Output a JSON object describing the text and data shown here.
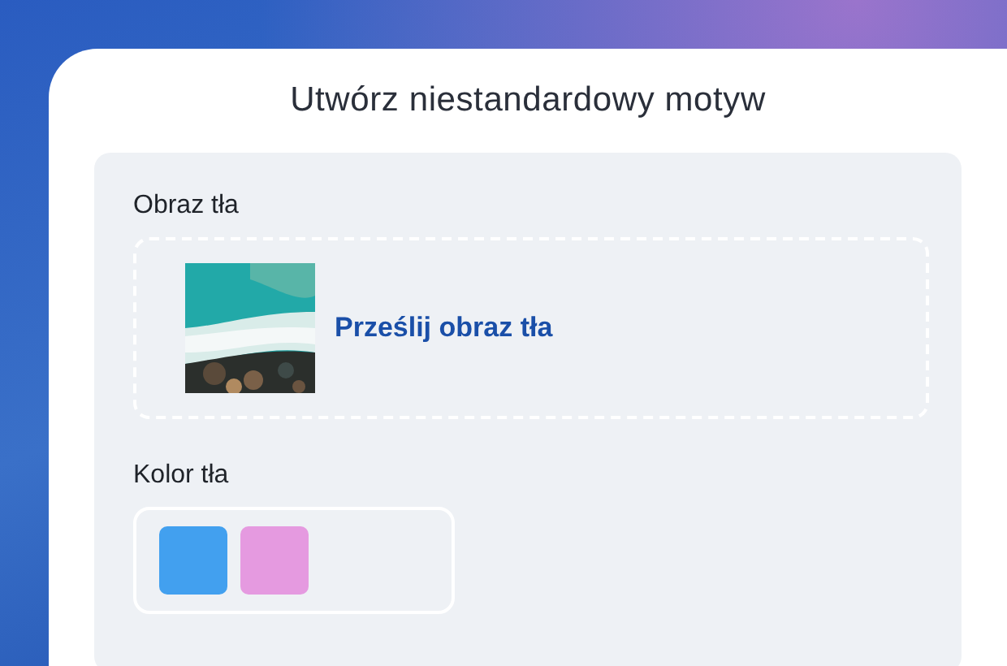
{
  "title": "Utwórz niestandardowy motyw",
  "background_image": {
    "label": "Obraz tła",
    "upload_link": "Prześlij obraz tła"
  },
  "background_color": {
    "label": "Kolor tła",
    "swatches": [
      {
        "color": "#42a0ef"
      },
      {
        "color": "#e59ae0"
      }
    ]
  }
}
